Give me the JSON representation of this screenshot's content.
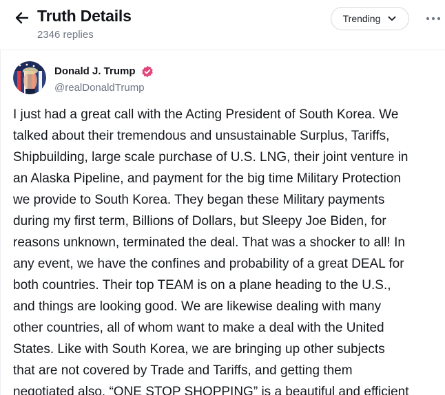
{
  "header": {
    "title": "Truth Details",
    "subtitle": "2346 replies",
    "sort_label": "Trending",
    "back_icon": "arrow-left-icon",
    "sort_icon": "chevron-down-icon",
    "more_icon": "more-horizontal-icon"
  },
  "post": {
    "author": {
      "name": "Donald J. Trump",
      "handle": "@realDonaldTrump",
      "verified": true,
      "badge_color": "#e0457b"
    },
    "lines": [
      "I just had a great call with the Acting President of South Korea. We",
      "talked about their tremendous and unsustainable Surplus, Tariffs,",
      "Shipbuilding, large scale purchase of U.S. LNG, their joint venture in",
      "an Alaska Pipeline, and payment for the big time Military Protection",
      "we provide to South Korea. They began these Military payments",
      "during my first term, Billions of Dollars, but Sleepy Joe Biden, for",
      "reasons unknown, terminated the deal. That was a shocker to all! In",
      "any event, we have the confines and probability of a great DEAL for",
      "both countries. Their top TEAM is on a plane heading to the U.S.,",
      "and things are looking good. We are likewise dealing with many",
      "other countries, all of whom want to make a deal with the United",
      "States. Like with South Korea, we are bringing up other subjects",
      "that are not covered by Trade and Tariffs, and getting them",
      "negotiated also. “ONE STOP SHOPPING” is a beautiful and efficient"
    ]
  }
}
